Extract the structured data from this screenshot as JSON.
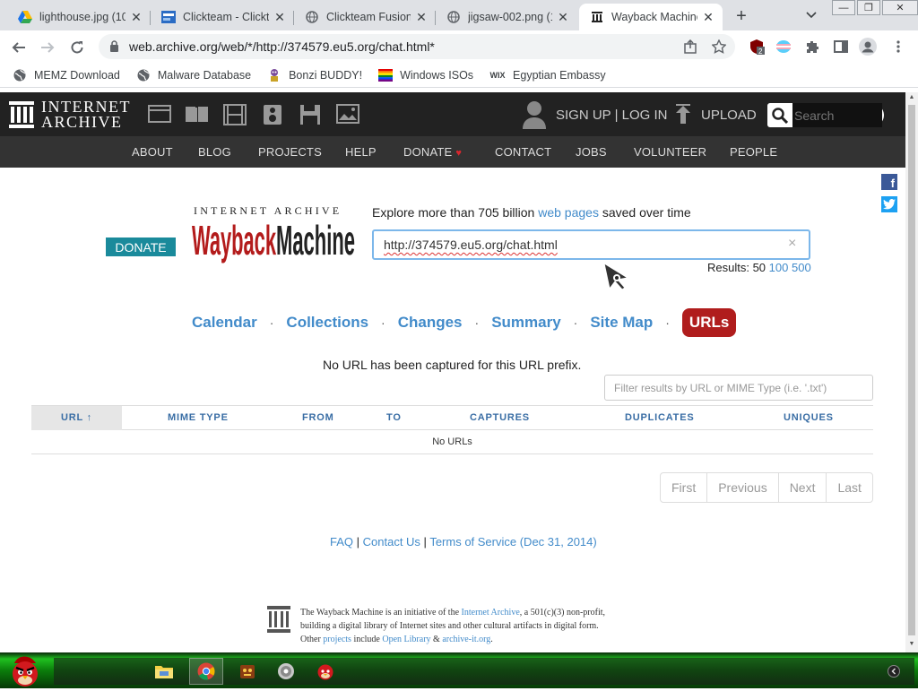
{
  "browser": {
    "tabs": [
      {
        "title": "lighthouse.jpg (10",
        "icon": "google-drive-icon",
        "active": false
      },
      {
        "title": "Clickteam - Clickt",
        "icon": "clickteam-icon",
        "active": false
      },
      {
        "title": "Clickteam Fusion",
        "icon": "globe-icon",
        "active": false
      },
      {
        "title": "jigsaw-002.png (1",
        "icon": "globe-icon",
        "active": false
      },
      {
        "title": "Wayback Machine",
        "icon": "internet-archive-icon",
        "active": true
      }
    ],
    "new_tab": "+",
    "address": "web.archive.org/web/*/http://374579.eu5.org/chat.html*",
    "extension_badge": "2",
    "bookmarks": [
      {
        "label": "MEMZ Download",
        "icon": "globe-icon"
      },
      {
        "label": "Malware Database",
        "icon": "globe-icon"
      },
      {
        "label": "Bonzi BUDDY!",
        "icon": "bonzi-icon"
      },
      {
        "label": "Windows ISOs",
        "icon": "rainbow-flag-icon"
      },
      {
        "label": "Egyptian Embassy",
        "icon": "wix-icon"
      }
    ]
  },
  "ia_header": {
    "logo_line1": "INTERNET",
    "logo_line2": "ARCHIVE",
    "signup": "SIGN UP | LOG IN",
    "upload": "UPLOAD",
    "search_placeholder": "Search",
    "nav": [
      "ABOUT",
      "BLOG",
      "PROJECTS",
      "HELP",
      "DONATE",
      "CONTACT",
      "JOBS",
      "VOLUNTEER",
      "PEOPLE"
    ]
  },
  "wayback": {
    "donate": "DONATE",
    "logo_top": "INTERNET ARCHIVE",
    "logo_main": "WaybackMachine",
    "explore_prefix": "Explore more than 705 billion ",
    "explore_link": "web pages",
    "explore_suffix": " saved over time",
    "input_value": "http://374579.eu5.org/chat.html",
    "clear": "×",
    "results_label": "Results: 50 ",
    "results_100": "100",
    "results_500": "500",
    "tabs": [
      "Calendar",
      "Collections",
      "Changes",
      "Summary",
      "Site Map",
      "URLs"
    ],
    "active_tab": "URLs",
    "no_url_message": "No URL has been captured for this URL prefix.",
    "filter_placeholder": "Filter results by URL or MIME Type (i.e. '.txt')",
    "table_headers": [
      "URL ↑",
      "MIME TYPE",
      "FROM",
      "TO",
      "CAPTURES",
      "DUPLICATES",
      "UNIQUES"
    ],
    "table_empty": "No URLs",
    "pager": [
      "First",
      "Previous",
      "Next",
      "Last"
    ]
  },
  "footer": {
    "faq": "FAQ",
    "sep1": " | ",
    "contact": "Contact Us",
    "sep2": " | ",
    "terms": "Terms of Service (Dec 31, 2014)",
    "line1_a": "The Wayback Machine is an initiative of the ",
    "line1_link": "Internet Archive",
    "line1_b": ", a 501(c)(3) non-profit,",
    "line2": "building a digital library of Internet sites and other cultural artifacts in digital form.",
    "line3_a": "Other ",
    "line3_link1": "projects",
    "line3_b": " include ",
    "line3_link2": "Open Library",
    "line3_c": " & ",
    "line3_link3": "archive-it.org",
    "line3_d": "."
  },
  "taskbar": {
    "items": [
      "start-angry-bird-icon",
      "file-explorer-icon",
      "chrome-icon",
      "game-icon",
      "disc-icon",
      "angry-bird-app-icon"
    ]
  },
  "colors": {
    "ia_bar": "#222222",
    "ia_nav": "#333333",
    "link": "#428bca",
    "donate_teal": "#1a8a9b",
    "active_tab_red": "#b01d1d",
    "logo_red": "#b31b1b"
  }
}
